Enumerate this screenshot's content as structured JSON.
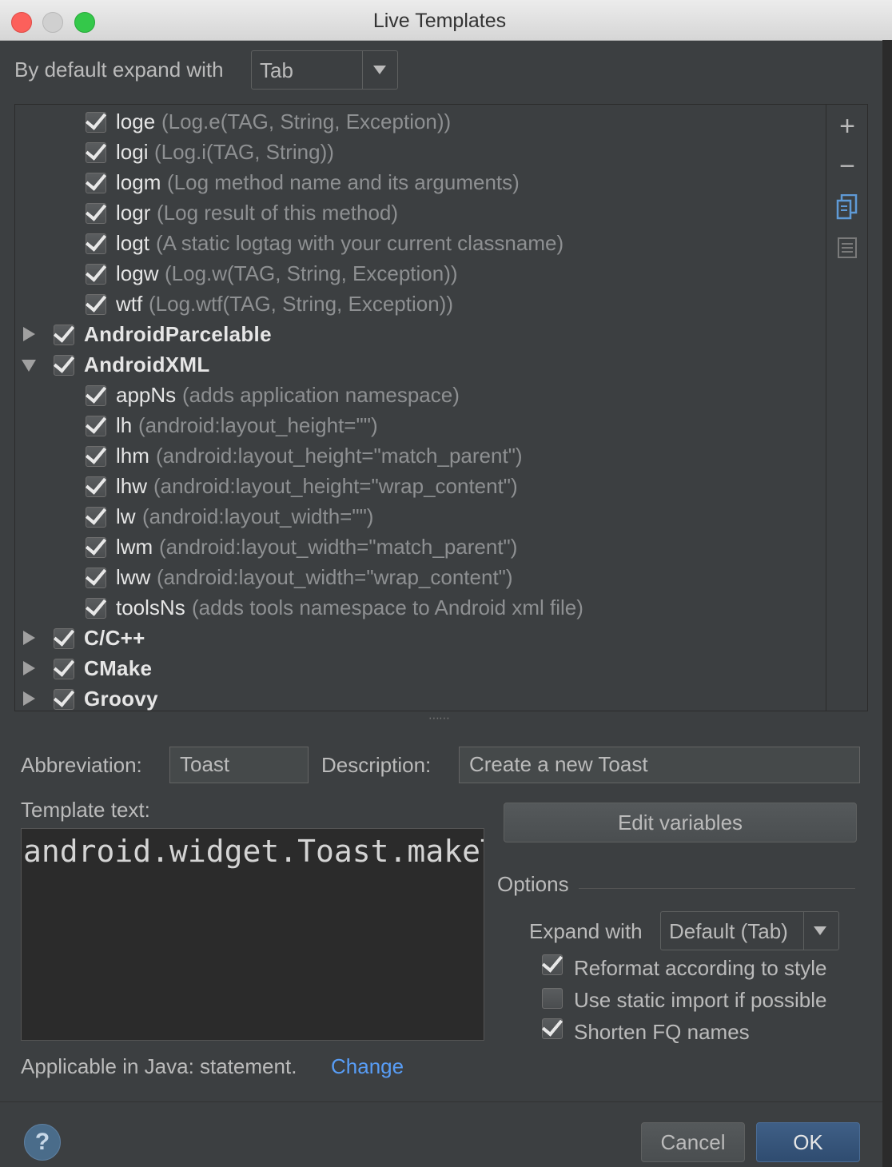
{
  "window": {
    "title": "Live Templates"
  },
  "expand_default": {
    "label": "By default expand with",
    "value": "Tab"
  },
  "tree": {
    "rows": [
      {
        "type": "item",
        "name": "loge",
        "desc": "(Log.e(TAG, String, Exception))"
      },
      {
        "type": "item",
        "name": "logi",
        "desc": "(Log.i(TAG, String))"
      },
      {
        "type": "item",
        "name": "logm",
        "desc": "(Log method name and its arguments)"
      },
      {
        "type": "item",
        "name": "logr",
        "desc": "(Log result of this method)"
      },
      {
        "type": "item",
        "name": "logt",
        "desc": "(A static logtag with your current classname)"
      },
      {
        "type": "item",
        "name": "logw",
        "desc": "(Log.w(TAG, String, Exception))"
      },
      {
        "type": "item",
        "name": "wtf",
        "desc": "(Log.wtf(TAG, String, Exception))"
      },
      {
        "type": "group",
        "name": "AndroidParcelable",
        "expanded": false
      },
      {
        "type": "group",
        "name": "AndroidXML",
        "expanded": true
      },
      {
        "type": "item",
        "name": "appNs",
        "desc": "(adds application namespace)"
      },
      {
        "type": "item",
        "name": "lh",
        "desc": "(android:layout_height=\"\")"
      },
      {
        "type": "item",
        "name": "lhm",
        "desc": "(android:layout_height=\"match_parent\")"
      },
      {
        "type": "item",
        "name": "lhw",
        "desc": "(android:layout_height=\"wrap_content\")"
      },
      {
        "type": "item",
        "name": "lw",
        "desc": "(android:layout_width=\"\")"
      },
      {
        "type": "item",
        "name": "lwm",
        "desc": "(android:layout_width=\"match_parent\")"
      },
      {
        "type": "item",
        "name": "lww",
        "desc": "(android:layout_width=\"wrap_content\")"
      },
      {
        "type": "item",
        "name": "toolsNs",
        "desc": "(adds tools namespace to Android xml file)"
      },
      {
        "type": "group",
        "name": "C/C++",
        "expanded": false
      },
      {
        "type": "group",
        "name": "CMake",
        "expanded": false
      },
      {
        "type": "group",
        "name": "Groovy",
        "expanded": false
      }
    ],
    "toolbar": {
      "add": "+",
      "remove": "−"
    }
  },
  "editor": {
    "abbreviation_label": "Abbreviation:",
    "abbreviation_value": "Toast",
    "description_label": "Description:",
    "description_value": "Create a new Toast",
    "template_label": "Template text:",
    "template_text": "android.widget.Toast.makeText($className$, \"$text$\", Toast.LENGTH_SHORT).show();",
    "edit_variables": "Edit variables",
    "options_label": "Options",
    "expand_with_label": "Expand with",
    "expand_with_value": "Default (Tab)",
    "reformat": "Reformat according to style",
    "static_import": "Use static import if possible",
    "shorten_fq": "Shorten FQ names",
    "applicable": "Applicable in Java: statement.",
    "change": "Change"
  },
  "buttons": {
    "help": "?",
    "cancel": "Cancel",
    "ok": "OK"
  },
  "colors": {
    "background": "#3c3f41",
    "editor_bg": "#2b2b2b",
    "link": "#589df6",
    "primary": "#365880"
  }
}
